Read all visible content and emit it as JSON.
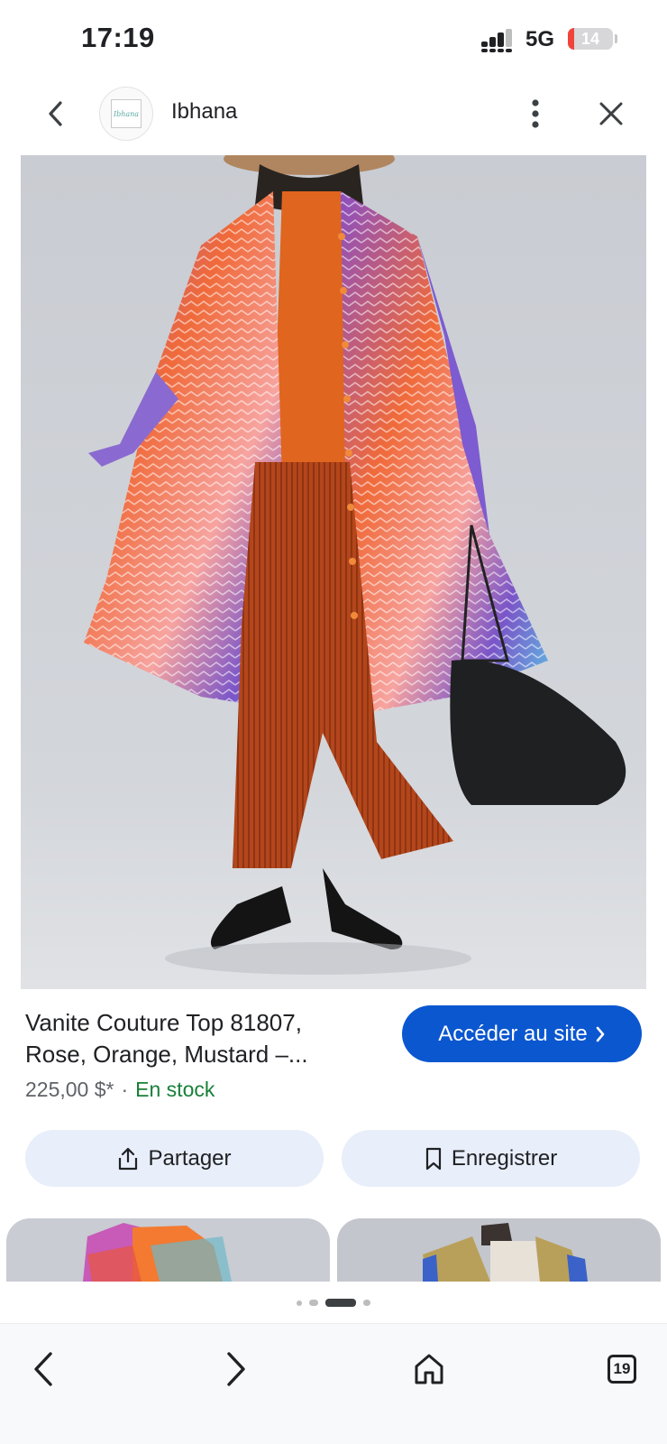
{
  "status_bar": {
    "time": "17:19",
    "network": "5G",
    "battery": "14",
    "battery_level": 0.14,
    "battery_color": "#f0443b"
  },
  "header": {
    "site_name": "Ibhana",
    "logo_text": "Ibhana"
  },
  "product": {
    "title_line1": "Vanite Couture Top 81807,",
    "title_line2": "Rose, Orange, Mustard –...",
    "price": "225,00 $*",
    "separator": "·",
    "stock": "En stock",
    "visit_label": "Accéder au site"
  },
  "actions": {
    "share_label": "Partager",
    "save_label": "Enregistrer"
  },
  "pager": {
    "count": 4,
    "active_index": 2
  },
  "bottom_nav": {
    "tabs_count": "19"
  },
  "colors": {
    "accent": "#0b57d0",
    "stock": "#188038",
    "chip_bg": "#e8eefa"
  }
}
